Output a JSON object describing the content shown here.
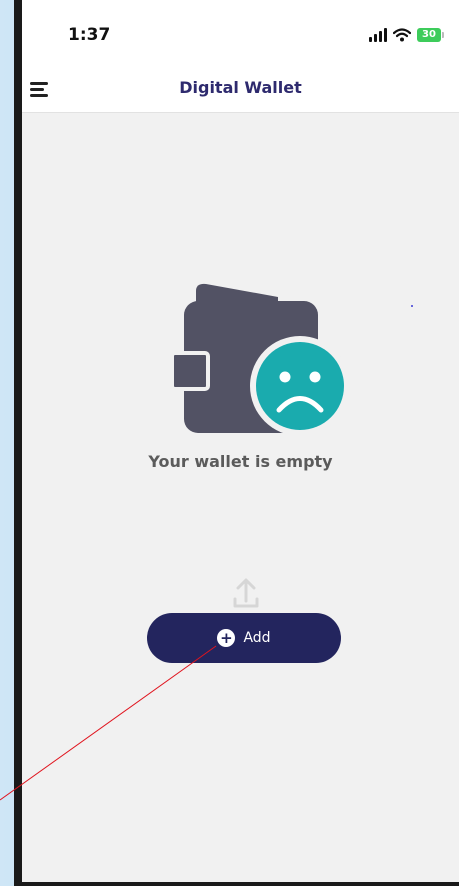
{
  "status_bar": {
    "time": "1:37",
    "battery_level": "30",
    "icons": [
      "signal-icon",
      "wifi-icon",
      "battery-icon"
    ]
  },
  "app_bar": {
    "title": "Digital Wallet",
    "menu_icon": "hamburger-menu-icon"
  },
  "empty_state": {
    "illustration": "sad-wallet-icon",
    "message": "Your wallet is empty"
  },
  "actions": {
    "upload_icon": "upload-icon",
    "add_icon": "plus-circle-icon",
    "add_label": "Add"
  },
  "colors": {
    "title": "#2e2a6e",
    "primary_button": "#23255e",
    "wallet_body": "#525264",
    "sad_face": "#1aabae",
    "annotation_line": "#e0141e",
    "battery": "#3dcc5b"
  }
}
